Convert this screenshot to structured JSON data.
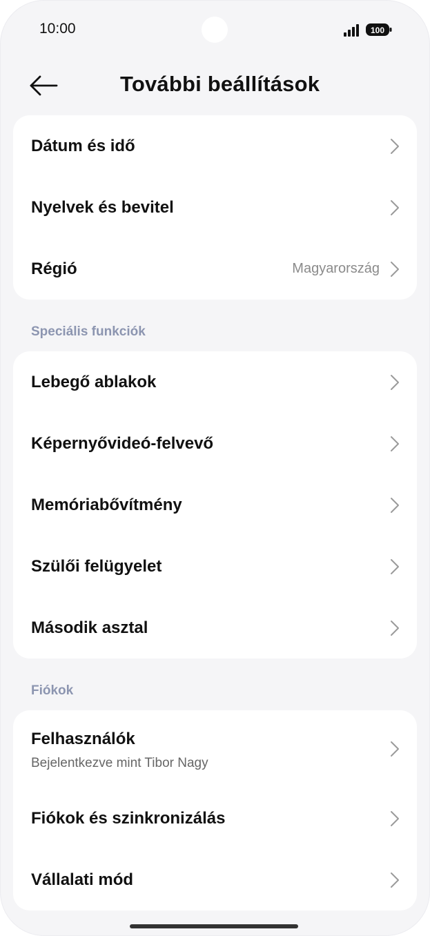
{
  "status": {
    "time": "10:00",
    "battery": "100",
    "signal_icon": "signal-bars-icon",
    "battery_icon": "battery-icon"
  },
  "header": {
    "title": "További beállítások",
    "back_icon": "arrow-left-icon"
  },
  "sections": [
    {
      "title": "",
      "items": [
        {
          "label": "Dátum és idő"
        },
        {
          "label": "Nyelvek és bevitel"
        },
        {
          "label": "Régió",
          "value": "Magyarország"
        }
      ]
    },
    {
      "title": "Speciális funkciók",
      "items": [
        {
          "label": "Lebegő ablakok"
        },
        {
          "label": "Képernyővideó-felvevő"
        },
        {
          "label": "Memóriabővítmény"
        },
        {
          "label": "Szülői felügyelet"
        },
        {
          "label": "Második asztal"
        }
      ]
    },
    {
      "title": "Fiókok",
      "items": [
        {
          "label": "Felhasználók",
          "subtitle": "Bejelentkezve mint Tibor Nagy"
        },
        {
          "label": "Fiókok és szinkronizálás"
        },
        {
          "label": "Vállalati mód"
        }
      ]
    }
  ],
  "colors": {
    "background": "#f5f5f7",
    "card": "#ffffff",
    "section_title": "#8c95b0",
    "chevron": "#9a9a9a"
  }
}
